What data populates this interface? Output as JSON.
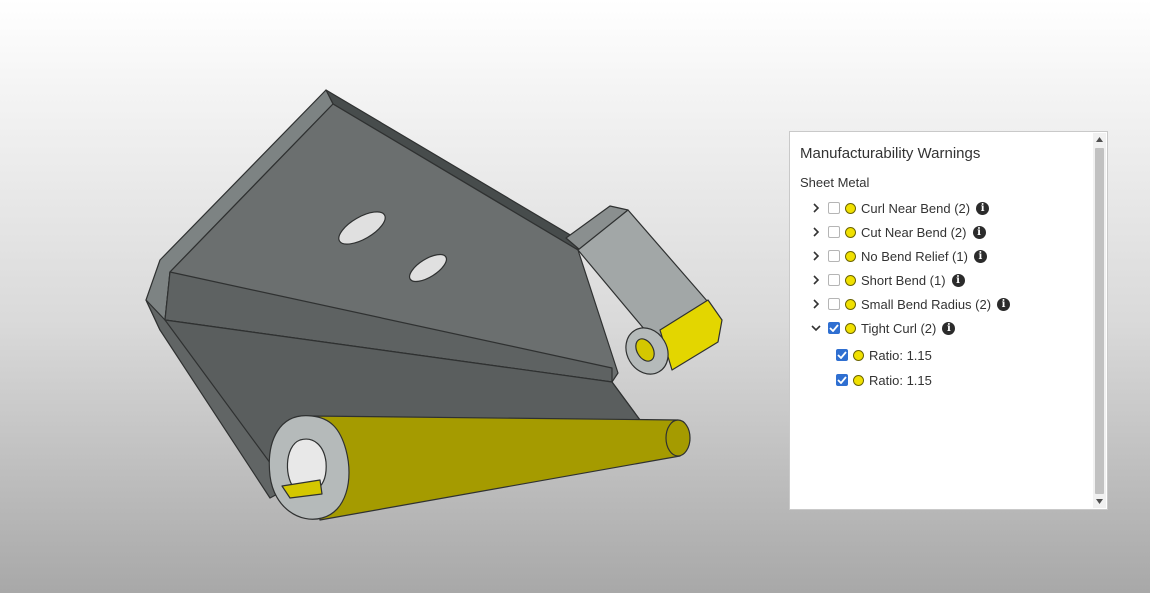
{
  "panel": {
    "title": "Manufacturability Warnings",
    "section": "Sheet Metal",
    "items": [
      {
        "label": "Curl Near Bend (2)",
        "expanded": false,
        "checked": false,
        "icon": "info-icon"
      },
      {
        "label": "Cut Near Bend (2)",
        "expanded": false,
        "checked": false,
        "icon": "info-icon"
      },
      {
        "label": "No Bend Relief (1)",
        "expanded": false,
        "checked": false,
        "icon": "info-icon"
      },
      {
        "label": "Short Bend (1)",
        "expanded": false,
        "checked": false,
        "icon": "info-icon"
      },
      {
        "label": "Small Bend Radius (2)",
        "expanded": false,
        "checked": false,
        "icon": "info-icon"
      },
      {
        "label": "Tight Curl (2)",
        "expanded": true,
        "checked": true,
        "icon": "info-icon"
      }
    ],
    "children": [
      {
        "label": "Ratio: 1.15",
        "checked": true
      },
      {
        "label": "Ratio: 1.15",
        "checked": true
      }
    ]
  },
  "colors": {
    "warning_dot": "#f0e000",
    "checkbox_checked": "#2f6fd1",
    "highlight_face": "#a59b00",
    "part_face": "#6b6f6f"
  }
}
